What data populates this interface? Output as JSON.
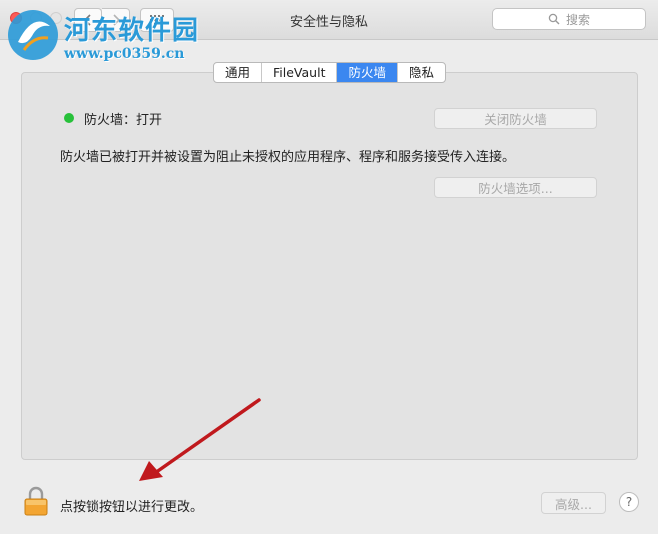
{
  "window": {
    "title": "安全性与隐私",
    "search_placeholder": "搜索"
  },
  "watermark": {
    "title": "河东软件园",
    "url": "www.pc0359.cn"
  },
  "tabs": [
    {
      "label": "通用",
      "active": false
    },
    {
      "label": "FileVault",
      "active": false
    },
    {
      "label": "防火墙",
      "active": true
    },
    {
      "label": "隐私",
      "active": false
    }
  ],
  "firewall": {
    "status": "防火墙：打开",
    "status_color": "#27c13a",
    "turn_off_label": "关闭防火墙",
    "description": "防火墙已被打开并被设置为阻止未授权的应用程序、程序和服务接受传入连接。",
    "options_label": "防火墙选项..."
  },
  "footer": {
    "lock_text": "点按锁按钮以进行更改。",
    "advanced_label": "高级...",
    "help_label": "?"
  },
  "colors": {
    "accent": "#3b87f0",
    "annotation_arrow": "#c0191d"
  }
}
